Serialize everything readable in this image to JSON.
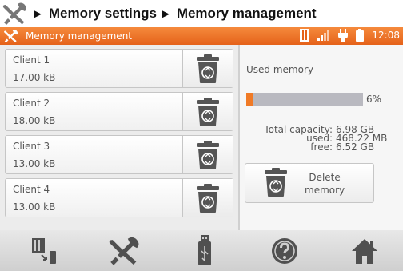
{
  "caption": {
    "crumb1": "Memory settings",
    "crumb2": "Memory management",
    "separator": "►"
  },
  "titlebar": {
    "title": "Memory management",
    "time": "12:08"
  },
  "clients": [
    {
      "name": "Client 1",
      "size": "17.00 kB"
    },
    {
      "name": "Client 2",
      "size": "18.00 kB"
    },
    {
      "name": "Client 3",
      "size": "13.00 kB"
    },
    {
      "name": "Client 4",
      "size": "13.00 kB"
    }
  ],
  "memory": {
    "used_label": "Used memory",
    "used_fraction": 0.06,
    "percent_text": "6%",
    "total_label": "Total capacity:",
    "total_value": "6.98 GB",
    "used_key": "used:",
    "used_value": "468.22 MB",
    "free_key": "free:",
    "free_value": "6.52 GB",
    "delete_line1": "Delete",
    "delete_line2": "memory"
  },
  "bottom_nav": [
    "memory-transfer-icon",
    "settings-tools-icon",
    "usb-icon",
    "help-icon",
    "home-icon"
  ],
  "colors": {
    "accent": "#f07a26",
    "titlebar": "#e5621a",
    "icon": "#505050"
  }
}
